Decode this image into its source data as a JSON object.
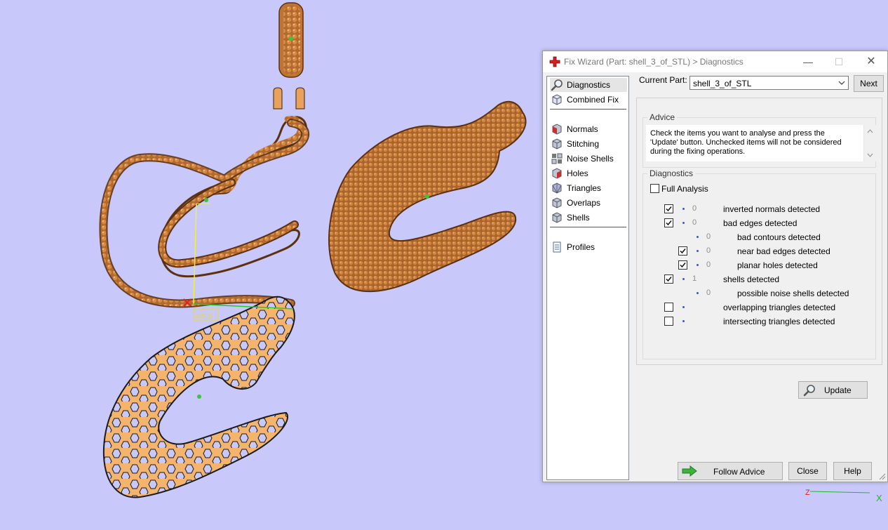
{
  "viewport": {
    "wcs_label": "WCS",
    "axis_z_label": "Z",
    "axis_x_label": "X"
  },
  "window": {
    "title": "Fix Wizard (Part: shell_3_of_STL) > Diagnostics",
    "minimize_icon": "minimize-icon",
    "maximize_icon": "maximize-icon",
    "close_icon": "close-icon"
  },
  "nav": {
    "items": [
      {
        "label": "Diagnostics",
        "icon": "magnifier-icon",
        "selected": true
      },
      {
        "label": "Combined Fix",
        "icon": "cube-icon"
      },
      {
        "label": "Normals",
        "icon": "normals-cube-icon"
      },
      {
        "label": "Stitching",
        "icon": "stitching-cube-icon"
      },
      {
        "label": "Noise Shells",
        "icon": "noise-shells-icon"
      },
      {
        "label": "Holes",
        "icon": "holes-cube-icon"
      },
      {
        "label": "Triangles",
        "icon": "triangles-cube-icon"
      },
      {
        "label": "Overlaps",
        "icon": "overlaps-cube-icon"
      },
      {
        "label": "Shells",
        "icon": "shells-cube-icon"
      },
      {
        "label": "Profiles",
        "icon": "profiles-icon"
      }
    ]
  },
  "current_part": {
    "label": "Current Part:",
    "value": "shell_3_of_STL"
  },
  "buttons": {
    "next": "Next",
    "update": "Update",
    "follow_advice": "Follow Advice",
    "close": "Close",
    "help": "Help"
  },
  "advice": {
    "legend": "Advice",
    "text": "Check the items you want to analyse and press the 'Update' button. Unchecked items will not be considered during the fixing operations."
  },
  "diagnostics": {
    "legend": "Diagnostics",
    "full_analysis": {
      "label": "Full Analysis",
      "checked": false
    },
    "rows": [
      {
        "label": "inverted normals detected",
        "count": "0",
        "checked": true
      },
      {
        "label": "bad edges detected",
        "count": "0",
        "checked": true
      },
      {
        "label": "bad contours detected",
        "count": "0",
        "checked": null
      },
      {
        "label": "near bad edges detected",
        "count": "0",
        "checked": true
      },
      {
        "label": "planar holes detected",
        "count": "0",
        "checked": true
      },
      {
        "label": "shells detected",
        "count": "1",
        "checked": true
      },
      {
        "label": "possible noise shells detected",
        "count": "0",
        "checked": null
      },
      {
        "label": "overlapping triangles detected",
        "count": "",
        "checked": false
      },
      {
        "label": "intersecting triangles detected",
        "count": "",
        "checked": false
      }
    ]
  },
  "colors": {
    "background": "#c8c8fa",
    "part_fill": "#f4b46e",
    "part_dark": "#a0602a",
    "accent_green": "#3cb43c"
  }
}
